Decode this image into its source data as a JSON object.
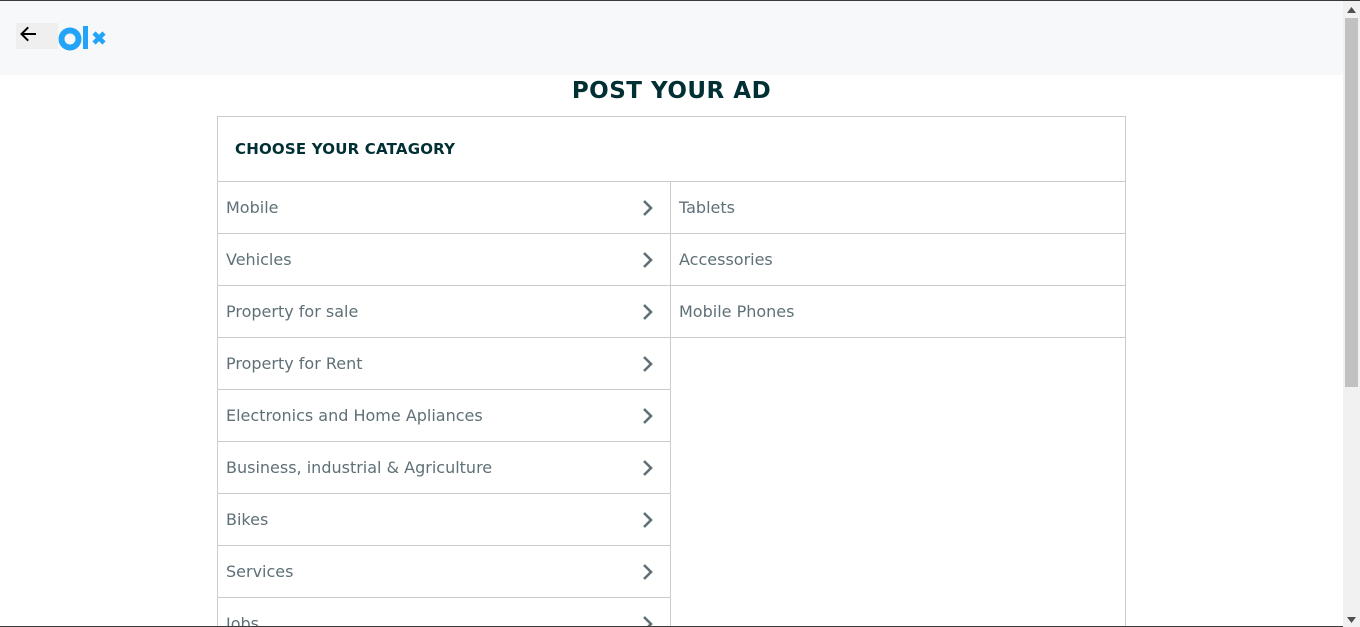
{
  "header": {
    "back_icon": "arrow-left-icon",
    "logo": "olx"
  },
  "page_title": "POST YOUR AD",
  "panel": {
    "heading": "CHOOSE YOUR CATAGORY",
    "categories": [
      {
        "label": "Mobile",
        "icon": "chevron-right-icon"
      },
      {
        "label": "Vehicles",
        "icon": "chevron-right-icon"
      },
      {
        "label": "Property for sale",
        "icon": "chevron-right-icon"
      },
      {
        "label": "Property for Rent",
        "icon": "chevron-right-icon"
      },
      {
        "label": "Electronics and Home Apliances",
        "icon": "chevron-right-icon"
      },
      {
        "label": "Business, industrial & Agriculture",
        "icon": "chevron-right-icon"
      },
      {
        "label": "Bikes",
        "icon": "chevron-right-icon"
      },
      {
        "label": "Services",
        "icon": "chevron-right-icon"
      },
      {
        "label": "Jobs",
        "icon": "chevron-right-icon"
      }
    ],
    "subcategories": [
      {
        "label": "Tablets"
      },
      {
        "label": "Accessories"
      },
      {
        "label": "Mobile Phones"
      }
    ]
  },
  "colors": {
    "title": "#002f34",
    "item_text": "#5f7077",
    "chevron": "#5f7077",
    "logo_blue": "#23a4f8",
    "border": "#c8cccd"
  }
}
